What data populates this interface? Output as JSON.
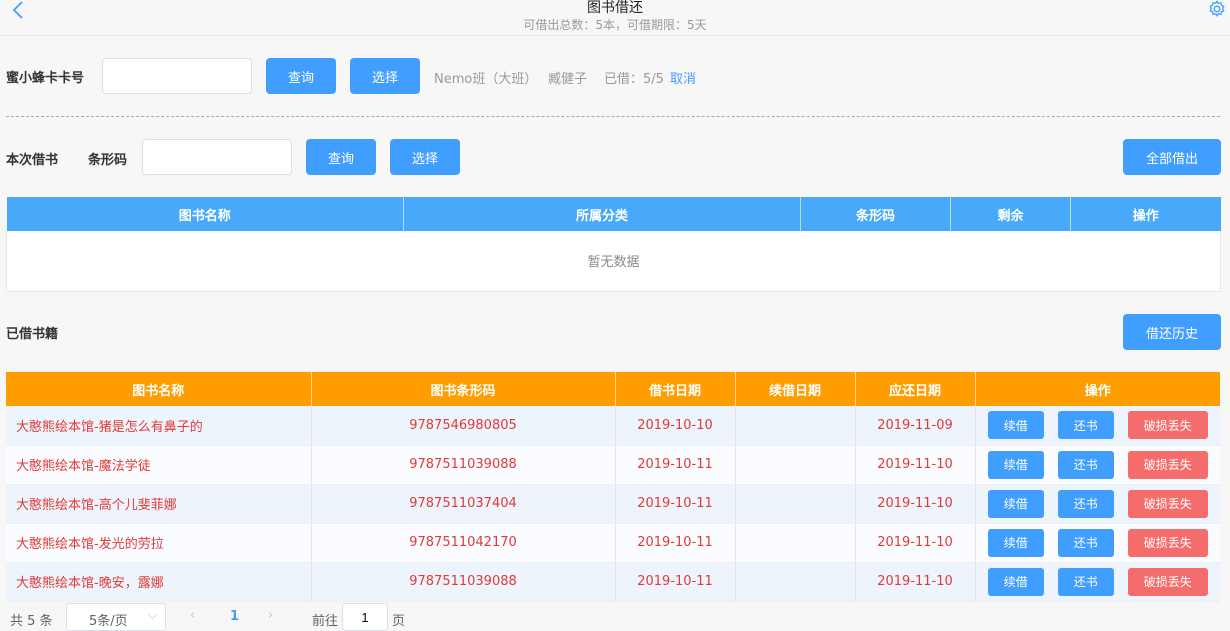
{
  "header": {
    "title": "图书借还",
    "subtitle": "可借出总数：5本，可借期限：5天"
  },
  "card": {
    "label": "蜜小蜂卡卡号",
    "value": "",
    "query": "查询",
    "select": "选择",
    "class_info": "Nemo班（大班）",
    "student": "臧健子",
    "borrowed": "已借：5/5",
    "cancel": "取消"
  },
  "borrow": {
    "label": "本次借书",
    "barcode_label": "条形码",
    "value": "",
    "query": "查询",
    "select": "选择",
    "all_borrow": "全部借出"
  },
  "borrow_table": {
    "columns": [
      "图书名称",
      "所属分类",
      "条形码",
      "剩余",
      "操作"
    ],
    "empty": "暂无数据"
  },
  "borrowed_section": {
    "title": "已借书籍",
    "history": "借还历史",
    "columns": [
      "图书名称",
      "图书条形码",
      "借书日期",
      "续借日期",
      "应还日期",
      "操作"
    ],
    "actions": {
      "renew": "续借",
      "return": "还书",
      "lost": "破损丢失"
    },
    "rows": [
      {
        "name": "大憨熊绘本馆-猪是怎么有鼻子的",
        "barcode": "9787546980805",
        "date": "2019-10-10",
        "renew_date": "",
        "due": "2019-11-09"
      },
      {
        "name": "大憨熊绘本馆-魔法学徒",
        "barcode": "9787511039088",
        "date": "2019-10-11",
        "renew_date": "",
        "due": "2019-11-10"
      },
      {
        "name": "大憨熊绘本馆-高个儿斐菲娜",
        "barcode": "9787511037404",
        "date": "2019-10-11",
        "renew_date": "",
        "due": "2019-11-10"
      },
      {
        "name": "大憨熊绘本馆-发光的劳拉",
        "barcode": "9787511042170",
        "date": "2019-10-11",
        "renew_date": "",
        "due": "2019-11-10"
      },
      {
        "name": "大憨熊绘本馆-晚安，露娜",
        "barcode": "9787511039088",
        "date": "2019-10-11",
        "renew_date": "",
        "due": "2019-11-10"
      }
    ]
  },
  "pager": {
    "total": "共 5 条",
    "size": "5条/页",
    "current": "1",
    "goto": "前往",
    "goto_value": "1",
    "page_unit": "页"
  },
  "colors": {
    "primary": "#409eff",
    "header_blue": "#48a9fb",
    "header_orange": "#ff9d00",
    "danger": "#f56c6c",
    "text_red": "#e03a3a"
  },
  "icons": [
    "back-icon",
    "gear-icon",
    "chevron-down-icon",
    "chevron-left-icon",
    "chevron-right-icon"
  ]
}
